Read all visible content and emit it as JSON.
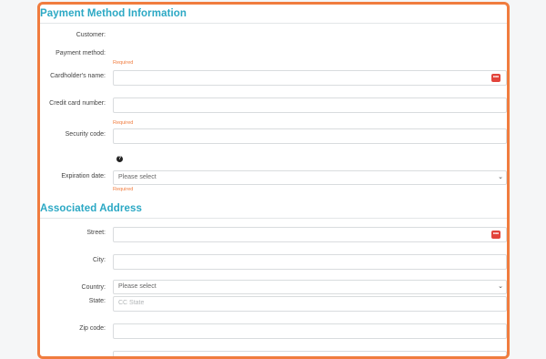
{
  "payment": {
    "title": "Payment Method Information",
    "customer_label": "Customer:",
    "method_label": "Payment method:",
    "required_1": "Required",
    "cardholder_label": "Cardholder's name:",
    "card_number_label": "Credit card number:",
    "required_2": "Required",
    "security_label": "Security code:",
    "help_glyph": "?",
    "expiration_label": "Expiration date:",
    "expiration_value": "Please select",
    "required_3": "Required"
  },
  "address": {
    "title": "Associated Address",
    "street_label": "Street:",
    "city_label": "City:",
    "country_label": "Country:",
    "country_value": "Please select",
    "state_label": "State:",
    "state_placeholder": "CC State",
    "zip_label": "Zip code:"
  },
  "icons": {
    "autofill_glyph": "•••",
    "chevron_glyph": "⌄"
  },
  "colors": {
    "accent": "#2ba8c4",
    "highlight_border": "#f07c3e",
    "required_text": "#f07c3e",
    "autofill_badge": "#e2443b"
  }
}
